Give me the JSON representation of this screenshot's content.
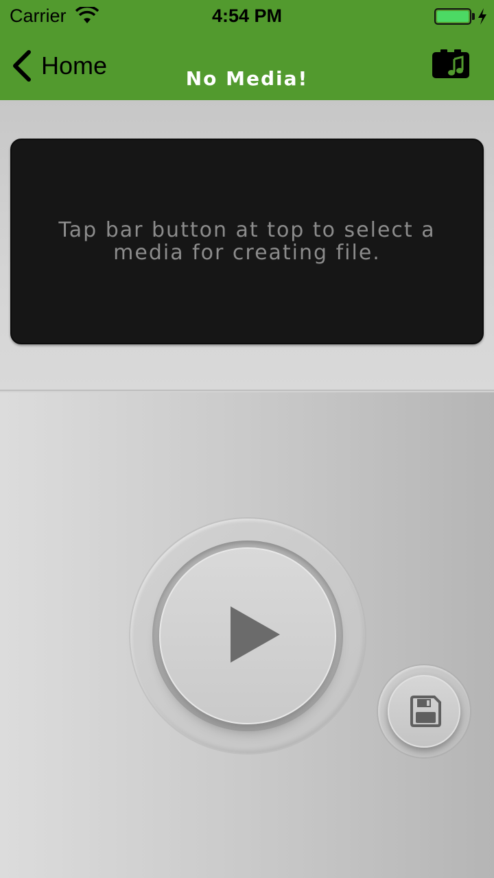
{
  "status_bar": {
    "carrier": "Carrier",
    "time": "4:54 PM",
    "battery_color": "#4cd964"
  },
  "nav": {
    "back_label": "Home",
    "title": "No Media!",
    "background": "#529a2e",
    "media_button_icon": "music-video-icon"
  },
  "media_panel": {
    "message": "Tap bar button at top to select a media for creating file."
  },
  "controls": {
    "play_icon": "play-icon",
    "save_icon": "floppy-disk-icon"
  }
}
